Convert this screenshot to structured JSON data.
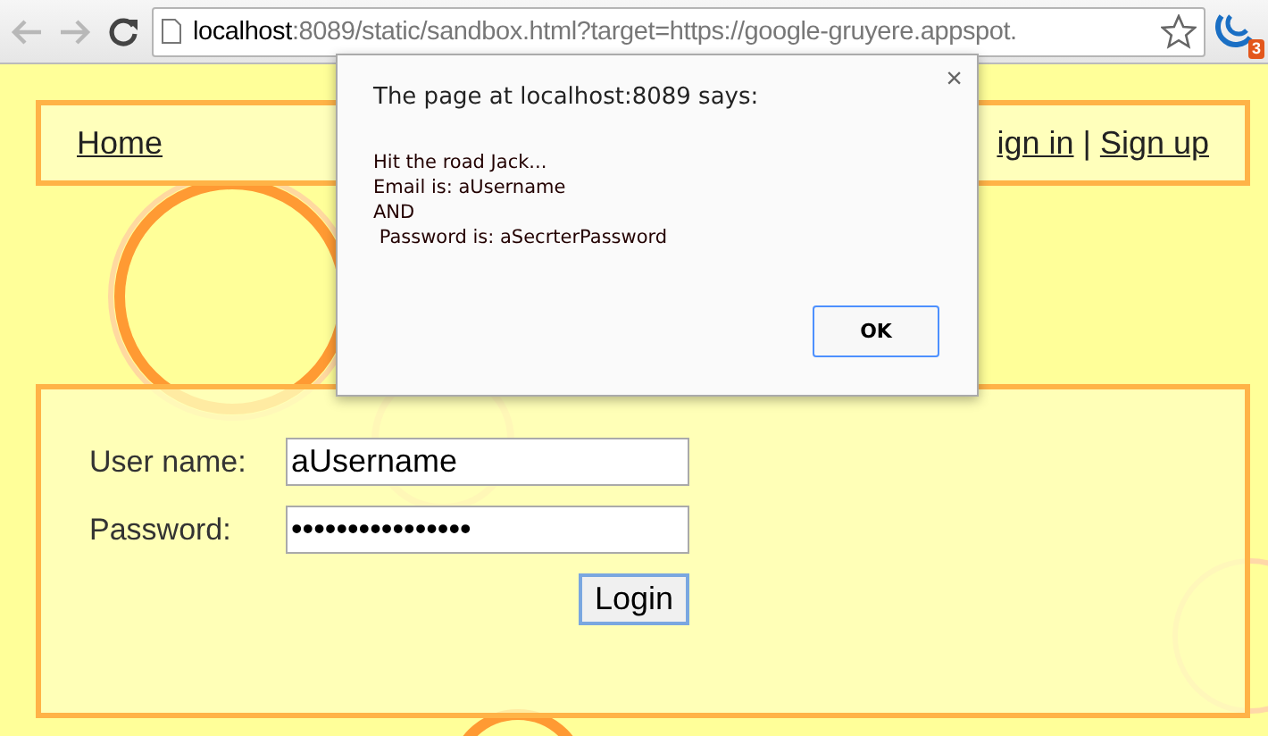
{
  "browser": {
    "url_host": "localhost",
    "url_rest": ":8089/static/sandbox.html?target=https://google-gruyere.appspot.",
    "extension_badge": "3"
  },
  "nav": {
    "left_link": "Home",
    "right_links": [
      "ign in",
      "Sign up"
    ],
    "separator": "|"
  },
  "login": {
    "fields": [
      {
        "label": "User name:",
        "value": "aUsername"
      },
      {
        "label": "Password:",
        "value": "••••••••••••••••"
      }
    ],
    "button": "Login"
  },
  "dialog": {
    "title": "The page at localhost:8089 says:",
    "close": "×",
    "lines": [
      "Hit the road Jack...",
      "Email is: aUsername",
      "AND",
      " Password is: aSecrterPassword"
    ],
    "button": "OK"
  }
}
